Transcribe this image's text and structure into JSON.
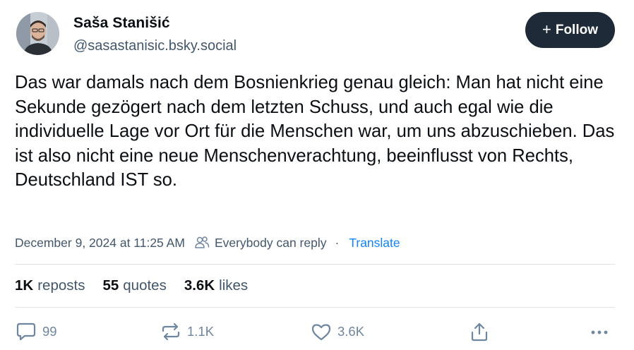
{
  "author": {
    "display_name": "Saša Stanišić",
    "handle": "@sasastanisic.bsky.social"
  },
  "follow_button": {
    "icon": "plus-icon",
    "label": "Follow"
  },
  "post": {
    "text": "Das war damals nach dem Bosnienkrieg genau gleich: Man hat nicht eine Sekunde gezögert nach dem letzten Schuss, und auch egal wie die individuelle Lage vor Ort für die Menschen war, um uns abzuschieben. Das ist also nicht eine neue Menschenverachtung, beeinflusst von Rechts, Deutschland IST so."
  },
  "meta": {
    "timestamp": "December 9, 2024 at 11:25 AM",
    "reply_setting_icon": "people-icon",
    "reply_setting": "Everybody can reply",
    "separator": "·",
    "translate": "Translate"
  },
  "stats": [
    {
      "count": "1K",
      "label": "reposts"
    },
    {
      "count": "55",
      "label": "quotes"
    },
    {
      "count": "3.6K",
      "label": "likes"
    }
  ],
  "actions": {
    "reply": {
      "icon": "reply-icon",
      "count": "99"
    },
    "repost": {
      "icon": "repost-icon",
      "count": "1.1K"
    },
    "like": {
      "icon": "heart-icon",
      "count": "3.6K"
    },
    "share": {
      "icon": "share-icon"
    },
    "more": {
      "icon": "more-icon"
    }
  },
  "colors": {
    "text": "#0b0f14",
    "secondary": "#42576c",
    "action": "#6f869f",
    "link": "#1083fe",
    "follow_bg": "#1e2a38",
    "divider": "#dfe3e8"
  }
}
